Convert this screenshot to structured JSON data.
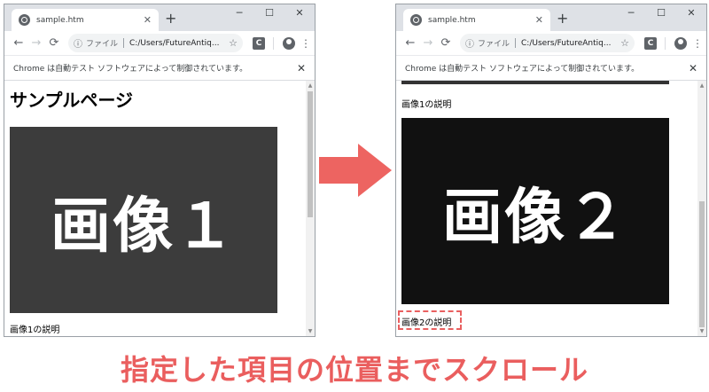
{
  "browser": {
    "tab_title": "sample.htm",
    "tab_close": "✕",
    "new_tab": "+",
    "window_controls": {
      "minimize": "─",
      "maximize": "☐",
      "close": "✕"
    },
    "nav": {
      "back": "←",
      "forward": "→",
      "reload": "⟳"
    },
    "omnibox": {
      "info_icon": "ⓘ",
      "scheme_label": "ファイル",
      "url": "C:/Users/FutureAntiq..."
    },
    "star": "☆",
    "extension_label": "C",
    "menu": "⋮",
    "infobar_message": "Chrome は自動テスト ソフトウェアによって制御されています。",
    "infobar_close": "✕"
  },
  "left_page": {
    "heading": "サンプルページ",
    "image_label": "画像１",
    "image_color": "#3c3c3c",
    "caption": "画像1の説明"
  },
  "right_page": {
    "caption_top": "画像1の説明",
    "image_label": "画像２",
    "image_color": "#111111",
    "caption_highlighted": "画像2の説明"
  },
  "arrow_color": "#ed6461",
  "bottom_caption": "指定した項目の位置までスクロール"
}
